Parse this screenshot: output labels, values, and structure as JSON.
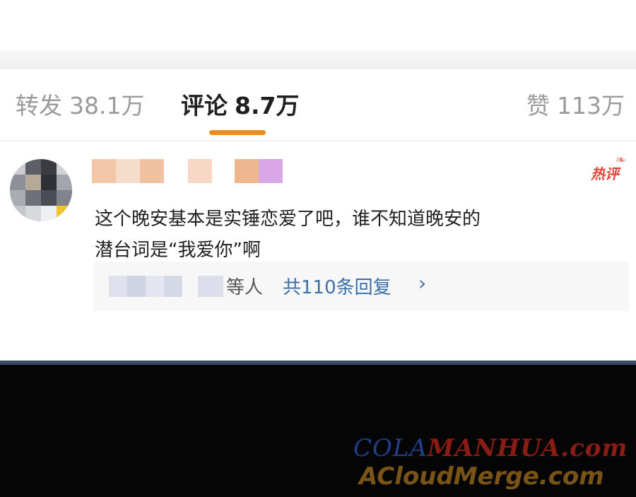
{
  "tabs": {
    "repost": {
      "label": "转发",
      "count": "38.1万"
    },
    "comment": {
      "label": "评论",
      "count": "8.7万"
    },
    "like": {
      "label": "赞",
      "count": "113万"
    }
  },
  "comment": {
    "badge": "热评",
    "text_line1": "这个晚安基本是实锤恋爱了吧，谁不知道晚安的",
    "text_line2": "潜台词是“我爱你”啊",
    "reply_suffix": "等人",
    "reply_link": "共110条回复",
    "reply_chevron": "›"
  },
  "watermark": {
    "part1": "COLA",
    "part2": "MANHUA.com",
    "line2": "ACloudMerge.com"
  },
  "colors": {
    "accent_underline": "#f08c1c",
    "link": "#3b6fa8",
    "hot_badge": "#e2453b"
  }
}
